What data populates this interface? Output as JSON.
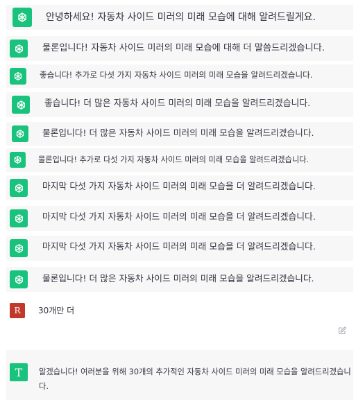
{
  "conversation": {
    "assistant_messages": [
      "안녕하세요! 자동차 사이드 미러의 미래 모습에 대해 알려드릴게요.",
      "물론입니다! 자동차 사이드 미러의 미래 모습에 대해 더 말씀드리겠습니다.",
      "좋습니다! 추가로 다섯 가지 자동차 사이드 미러의 미래 모습을 알려드리겠습니다.",
      "좋습니다! 더 많은 자동차 사이드 미러의 미래 모습을 알려드리겠습니다.",
      "물론입니다! 더 많은 자동차 사이드 미러의 미래 모습을 알려드리겠습니다.",
      "물론입니다! 추가로 다섯 가지 자동차 사이드 미러의 미래 모습을 알려드리겠습니다.",
      "마지막 다섯 가지 자동차 사이드 미러의 미래 모습을 더 알려드리겠습니다.",
      "마지막 다섯 가지 자동차 사이드 미러의 미래 모습을 더 알려드리겠습니다.",
      "마지막 다섯 가지 자동차 사이드 미러의 미래 모습을 더 알려드리겠습니다.",
      "물론입니다! 더 많은 자동차 사이드 미러의 미래 모습을 알려드리겠습니다."
    ],
    "user_message": {
      "avatar_letter": "R",
      "text": "30개만 더"
    },
    "final_response": {
      "avatar_letter": "T",
      "text": "알겠습니다! 여러분을 위해 30개의 추가적인 자동차 사이드 미러의 미래 모습을 알려드리겠습니다."
    }
  },
  "colors": {
    "assistant_avatar": "#19c37d",
    "user_avatar": "#c0392b",
    "strip_background": "#f7f7f8"
  }
}
